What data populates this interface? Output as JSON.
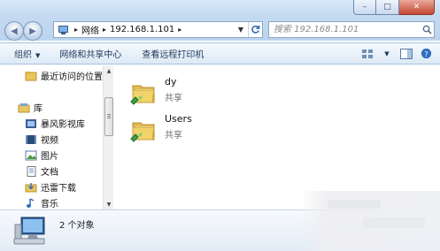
{
  "address": {
    "crumbs": [
      "网络",
      "192.168.1.101"
    ],
    "icon": "network-computer-icon"
  },
  "search": {
    "placeholder": "搜索 192.168.1.101"
  },
  "toolbar": {
    "organize_label": "组织",
    "network_share_center_label": "网络和共享中心",
    "remote_printers_label": "查看远程打印机"
  },
  "navigation": {
    "items": [
      {
        "label": "最近访问的位置",
        "icon": "recent-places-icon"
      },
      {
        "label": "库",
        "icon": "library-icon"
      },
      {
        "label": "暴风影视库",
        "icon": "video-library-icon"
      },
      {
        "label": "视频",
        "icon": "videos-icon"
      },
      {
        "label": "图片",
        "icon": "pictures-icon"
      },
      {
        "label": "文档",
        "icon": "documents-icon"
      },
      {
        "label": "迅雷下载",
        "icon": "download-icon"
      },
      {
        "label": "音乐",
        "icon": "music-icon"
      }
    ]
  },
  "shares": [
    {
      "name": "dy",
      "type": "共享",
      "icon": "shared-folder-icon"
    },
    {
      "name": "Users",
      "type": "共享",
      "icon": "shared-folder-icon"
    }
  ],
  "details": {
    "count_text": "2 个对象",
    "icon": "computer-icon"
  },
  "colors": {
    "chrome_top": "#d8e8f8",
    "command_bar": "#dde9f6",
    "folder_yellow": "#f1d36a",
    "share_green": "#3aa04a",
    "close_red": "#c64632"
  }
}
